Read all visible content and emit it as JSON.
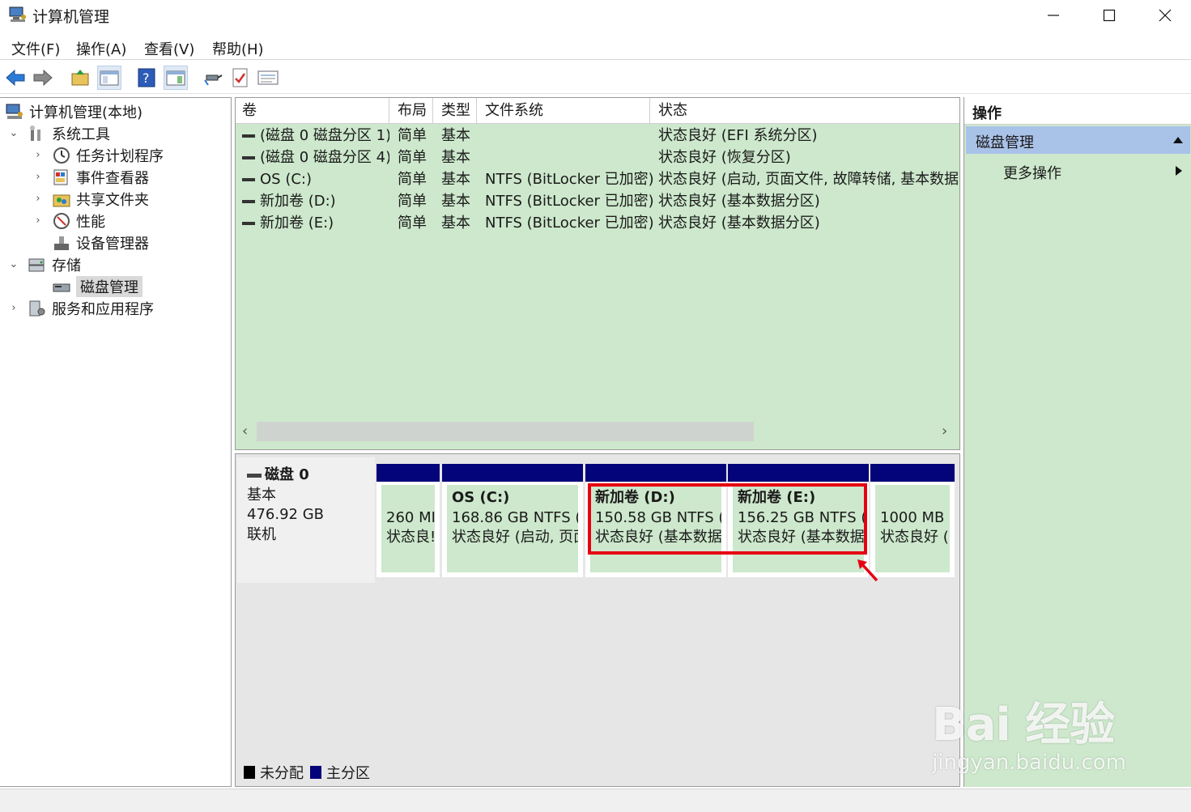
{
  "window": {
    "title": "计算机管理"
  },
  "menu": [
    "文件(F)",
    "操作(A)",
    "查看(V)",
    "帮助(H)"
  ],
  "tree": {
    "root": "计算机管理(本地)",
    "system_tools": "系统工具",
    "task_scheduler": "任务计划程序",
    "event_viewer": "事件查看器",
    "shared_folders": "共享文件夹",
    "performance": "性能",
    "device_manager": "设备管理器",
    "storage": "存储",
    "disk_management": "磁盘管理",
    "services_apps": "服务和应用程序"
  },
  "list": {
    "columns": [
      "卷",
      "布局",
      "类型",
      "文件系统",
      "状态"
    ],
    "rows": [
      [
        "(磁盘 0 磁盘分区 1)",
        "简单",
        "基本",
        "",
        "状态良好 (EFI 系统分区)"
      ],
      [
        "(磁盘 0 磁盘分区 4)",
        "简单",
        "基本",
        "",
        "状态良好 (恢复分区)"
      ],
      [
        "OS (C:)",
        "简单",
        "基本",
        "NTFS (BitLocker 已加密)",
        "状态良好 (启动, 页面文件, 故障转储, 基本数据分"
      ],
      [
        "新加卷 (D:)",
        "简单",
        "基本",
        "NTFS (BitLocker 已加密)",
        "状态良好 (基本数据分区)"
      ],
      [
        "新加卷 (E:)",
        "简单",
        "基本",
        "NTFS (BitLocker 已加密)",
        "状态良好 (基本数据分区)"
      ]
    ],
    "scroll_left": "‹",
    "scroll_right": "›"
  },
  "disk": {
    "name": "磁盘 0",
    "type": "基本",
    "size": "476.92 GB",
    "status": "联机",
    "partitions": [
      {
        "title": "",
        "line1": "260 MI",
        "line2": "状态良!"
      },
      {
        "title": "OS  (C:)",
        "line1": "168.86 GB NTFS (E",
        "line2": "状态良好 (启动, 页面"
      },
      {
        "title": "新加卷  (D:)",
        "line1": "150.58 GB NTFS (E",
        "line2": "状态良好 (基本数据"
      },
      {
        "title": "新加卷  (E:)",
        "line1": "156.25 GB NTFS (E",
        "line2": "状态良好 (基本数据"
      },
      {
        "title": "",
        "line1": "1000 MB",
        "line2": "状态良好 ("
      }
    ]
  },
  "legend": {
    "unallocated": "未分配",
    "primary": "主分区"
  },
  "actions": {
    "title": "操作",
    "section": "磁盘管理",
    "more": "更多操作"
  },
  "watermark": {
    "big": "Bai 经验",
    "small": "jingyan.baidu.com"
  },
  "colors": {
    "list_bg": "#cde8cc",
    "partition_header": "#03037a",
    "highlight": "#e60012",
    "actions_section": "#a9c2e8"
  }
}
